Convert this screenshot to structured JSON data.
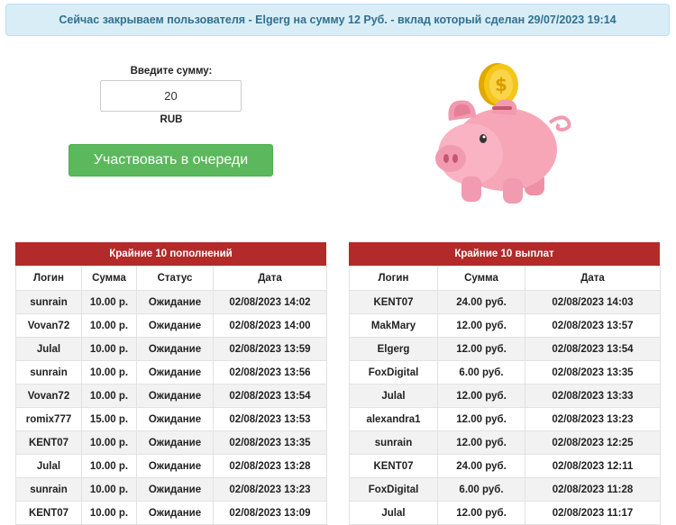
{
  "notice": {
    "text": "Сейчас закрываем пользователя - Elgerg на сумму 12 Руб. - вклад который сделан 29/07/2023 19:14"
  },
  "form": {
    "amount_label": "Введите сумму:",
    "amount_value": "20",
    "currency": "RUB",
    "submit_label": "Участвовать в очереди"
  },
  "deposits": {
    "title": "Крайние 10 пополнений",
    "columns": [
      "Логин",
      "Сумма",
      "Статус",
      "Дата"
    ],
    "rows": [
      [
        "sunrain",
        "10.00 р.",
        "Ожидание",
        "02/08/2023 14:02"
      ],
      [
        "Vovan72",
        "10.00 р.",
        "Ожидание",
        "02/08/2023 14:00"
      ],
      [
        "Julal",
        "10.00 р.",
        "Ожидание",
        "02/08/2023 13:59"
      ],
      [
        "sunrain",
        "10.00 р.",
        "Ожидание",
        "02/08/2023 13:56"
      ],
      [
        "Vovan72",
        "10.00 р.",
        "Ожидание",
        "02/08/2023 13:54"
      ],
      [
        "romix777",
        "15.00 р.",
        "Ожидание",
        "02/08/2023 13:53"
      ],
      [
        "KENT07",
        "10.00 р.",
        "Ожидание",
        "02/08/2023 13:35"
      ],
      [
        "Julal",
        "10.00 р.",
        "Ожидание",
        "02/08/2023 13:28"
      ],
      [
        "sunrain",
        "10.00 р.",
        "Ожидание",
        "02/08/2023 13:23"
      ],
      [
        "KENT07",
        "10.00 р.",
        "Ожидание",
        "02/08/2023 13:09"
      ]
    ]
  },
  "payouts": {
    "title": "Крайние 10 выплат",
    "columns": [
      "Логин",
      "Сумма",
      "Дата"
    ],
    "rows": [
      [
        "KENT07",
        "24.00 руб.",
        "02/08/2023 14:03"
      ],
      [
        "MakMary",
        "12.00 руб.",
        "02/08/2023 13:57"
      ],
      [
        "Elgerg",
        "12.00 руб.",
        "02/08/2023 13:54"
      ],
      [
        "FoxDigital",
        "6.00 руб.",
        "02/08/2023 13:35"
      ],
      [
        "Julal",
        "12.00 руб.",
        "02/08/2023 13:33"
      ],
      [
        "alexandra1",
        "12.00 руб.",
        "02/08/2023 13:23"
      ],
      [
        "sunrain",
        "12.00 руб.",
        "02/08/2023 12:25"
      ],
      [
        "KENT07",
        "24.00 руб.",
        "02/08/2023 12:11"
      ],
      [
        "FoxDigital",
        "6.00 руб.",
        "02/08/2023 11:28"
      ],
      [
        "Julal",
        "12.00 руб.",
        "02/08/2023 11:17"
      ]
    ]
  },
  "icons": {
    "piggy": "piggy-bank-with-coin-icon"
  },
  "colors": {
    "notice_bg": "#d9edf7",
    "notice_text": "#31708f",
    "button_green": "#5cb85c",
    "table_header_red": "#b22a2a",
    "piggy_pink": "#f7a6b8",
    "coin_gold": "#f5c518"
  }
}
